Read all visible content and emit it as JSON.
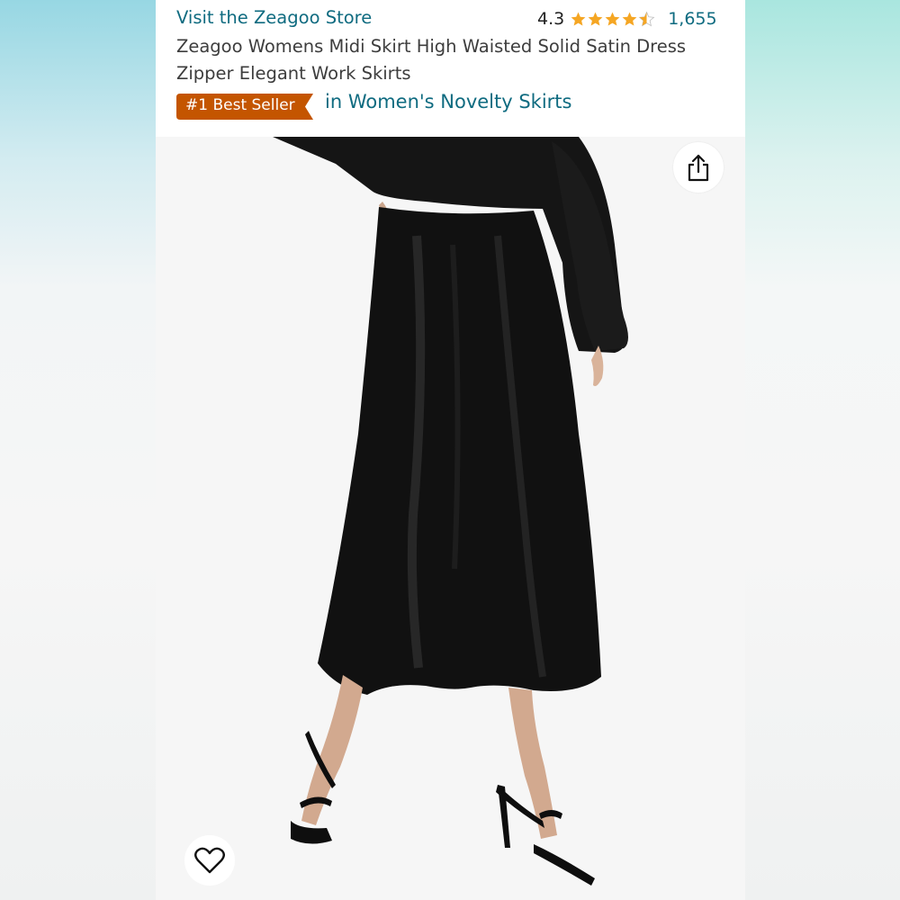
{
  "header": {
    "store_link": "Visit the Zeagoo Store",
    "rating_value": "4.3",
    "rating_stars": 4.3,
    "rating_count": "1,655",
    "title": "Zeagoo Womens Midi Skirt High Waisted Solid Satin Dress Zipper Elegant Work Skirts",
    "badge_label": "#1 Best Seller",
    "badge_category": "in Women's Novelty Skirts"
  },
  "image": {
    "actions": {
      "share_icon": "share-icon",
      "favorite_icon": "heart-icon"
    }
  },
  "colors": {
    "link": "#0f6b80",
    "badge": "#c45500",
    "star": "#f5a623"
  }
}
